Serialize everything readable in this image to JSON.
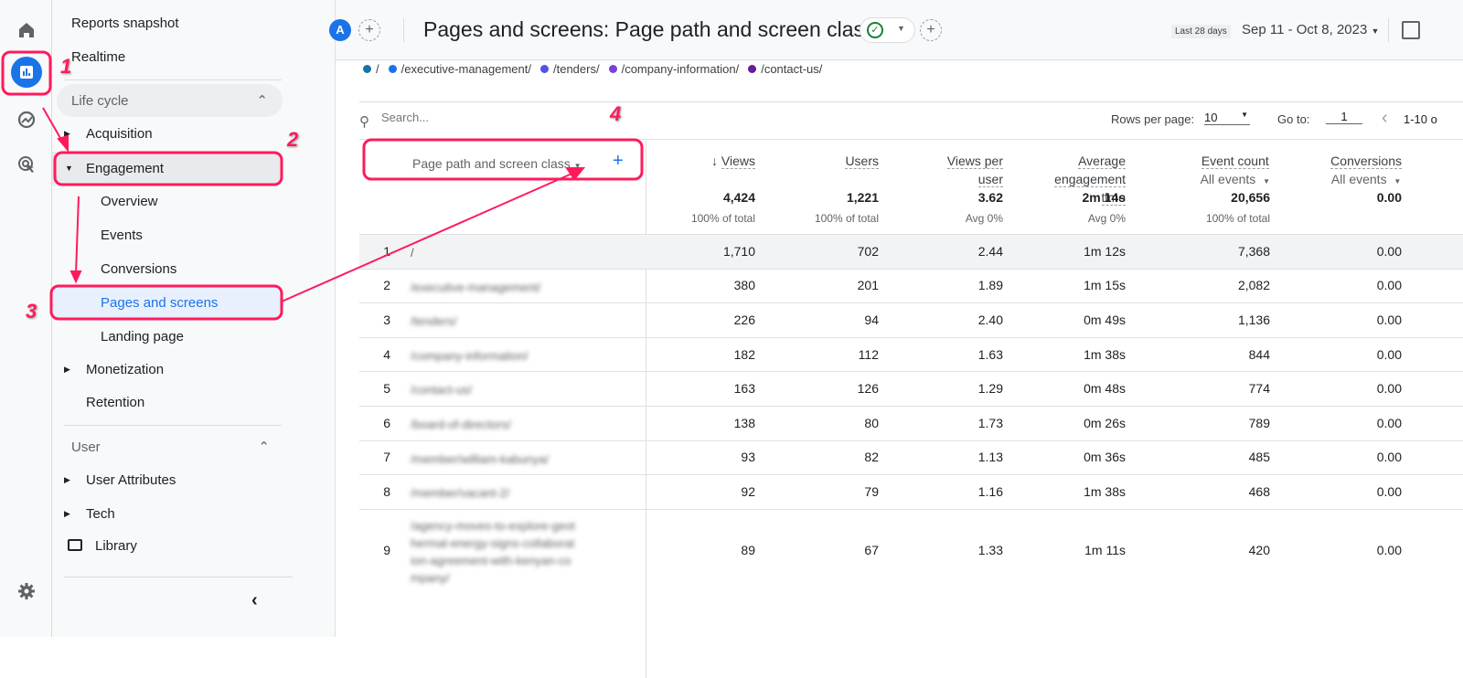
{
  "nav": {
    "reports_snapshot": "Reports snapshot",
    "realtime": "Realtime",
    "lifecycle": "Life cycle",
    "acquisition": "Acquisition",
    "engagement": "Engagement",
    "overview": "Overview",
    "events": "Events",
    "conversions": "Conversions",
    "pages": "Pages and screens",
    "landing": "Landing page",
    "monetization": "Monetization",
    "retention": "Retention",
    "user": "User",
    "user_attributes": "User Attributes",
    "tech": "Tech",
    "library": "Library"
  },
  "header": {
    "avatar": "A",
    "title": "Pages and screens: Page path and screen class",
    "range_chip": "Last 28 days",
    "date_range": "Sep 11 - Oct 8, 2023"
  },
  "legend": [
    {
      "label": "/",
      "color": "#1a73a8"
    },
    {
      "label": "/executive-management/",
      "color": "#1a73e8"
    },
    {
      "label": "/tenders/",
      "color": "#4f52e8"
    },
    {
      "label": "/company-information/",
      "color": "#7b3fdb"
    },
    {
      "label": "/contact-us/",
      "color": "#6a1b9a"
    }
  ],
  "toolbar": {
    "search_placeholder": "Search...",
    "rows_label": "Rows per page:",
    "rows_value": "10",
    "goto_label": "Go to:",
    "goto_value": "1",
    "range": "1-10 o"
  },
  "columns": {
    "dim": "Page path and screen class",
    "views": "Views",
    "users": "Users",
    "vpu1": "Views per",
    "vpu2": "user",
    "aet1": "Average",
    "aet2": "engagement",
    "aet3": "time",
    "events": "Event count",
    "events_sub": "All events",
    "conv": "Conversions",
    "conv_sub": "All events"
  },
  "totals": {
    "views": "4,424",
    "views_sub": "100% of total",
    "users": "1,221",
    "users_sub": "100% of total",
    "vpu": "3.62",
    "vpu_sub": "Avg 0%",
    "aet": "2m 14s",
    "aet_sub": "Avg 0%",
    "events": "20,656",
    "events_sub": "100% of total",
    "conv": "0.00"
  },
  "rows": [
    {
      "i": "1",
      "path": "/",
      "views": "1,710",
      "users": "702",
      "vpu": "2.44",
      "aet": "1m 12s",
      "events": "7,368",
      "conv": "0.00"
    },
    {
      "i": "2",
      "path": "/executive-management/",
      "views": "380",
      "users": "201",
      "vpu": "1.89",
      "aet": "1m 15s",
      "events": "2,082",
      "conv": "0.00"
    },
    {
      "i": "3",
      "path": "/tenders/",
      "views": "226",
      "users": "94",
      "vpu": "2.40",
      "aet": "0m 49s",
      "events": "1,136",
      "conv": "0.00"
    },
    {
      "i": "4",
      "path": "/company-information/",
      "views": "182",
      "users": "112",
      "vpu": "1.63",
      "aet": "1m 38s",
      "events": "844",
      "conv": "0.00"
    },
    {
      "i": "5",
      "path": "/contact-us/",
      "views": "163",
      "users": "126",
      "vpu": "1.29",
      "aet": "0m 48s",
      "events": "774",
      "conv": "0.00"
    },
    {
      "i": "6",
      "path": "/board-of-directors/",
      "views": "138",
      "users": "80",
      "vpu": "1.73",
      "aet": "0m 26s",
      "events": "789",
      "conv": "0.00"
    },
    {
      "i": "7",
      "path": "/member/william-kabunya/",
      "views": "93",
      "users": "82",
      "vpu": "1.13",
      "aet": "0m 36s",
      "events": "485",
      "conv": "0.00"
    },
    {
      "i": "8",
      "path": "/member/vacant-2/",
      "views": "92",
      "users": "79",
      "vpu": "1.16",
      "aet": "1m 38s",
      "events": "468",
      "conv": "0.00"
    },
    {
      "i": "9",
      "path": "/agency-moves-to-explore-geothermal-energy-signs-collaboration-agreement-with-kenyan-company/",
      "views": "89",
      "users": "67",
      "vpu": "1.33",
      "aet": "1m 11s",
      "events": "420",
      "conv": "0.00"
    }
  ],
  "annotations": [
    "1",
    "2",
    "3",
    "4"
  ],
  "colors": {
    "accent": "#1a73e8",
    "annotation": "#ff1a5c"
  }
}
